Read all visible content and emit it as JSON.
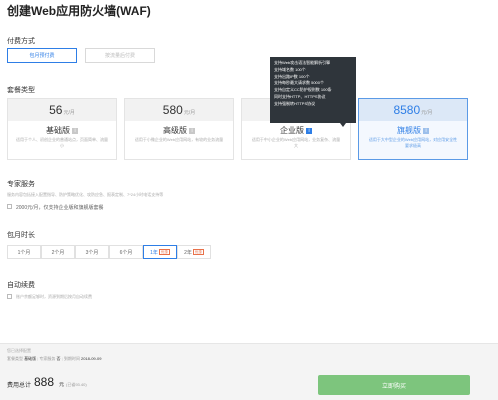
{
  "page_title": "创建Web应用防火墙(WAF)",
  "payment": {
    "label": "付费方式",
    "options": [
      "包月预付费",
      "按流量后付费"
    ]
  },
  "package": {
    "label": "套餐类型",
    "unit": "元/月",
    "info_icon_text": "i",
    "plans": [
      {
        "price": "56",
        "name": "基础版",
        "desc": "适用于个人、初创企业的普通站点，页面简单、流量小"
      },
      {
        "price": "580",
        "name": "高级版",
        "desc": "适用于小微企业的Web应用网站，有较的业务流量"
      },
      {
        "price": "",
        "name": "企业版",
        "desc": "适用于中小企业的Web应用网站，业务复杂、流量大"
      },
      {
        "price": "8580",
        "name": "旗舰版",
        "desc": "适用于大中型企业的Web应用网站，对应用安全性要求极高"
      }
    ]
  },
  "tooltip": {
    "lines": [
      "支持Web攻击语法智能解析引擎",
      "支持域名数 100个",
      "支持出路IP数 100个",
      "支持每秒最大请求数 5000个",
      "支持自定义CC防护规则数 100条",
      "同时支持HTTP、HTTPS协议",
      "支持强制转HTTPS协议"
    ]
  },
  "expert": {
    "label": "专家服务",
    "desc": "服务内容包括接入配置指导、防护策略优化、攻防应急、报表定制、7*24小时电话支持等",
    "checkbox_label": "2000元/月，仅支持企业版和旗舰版套餐"
  },
  "duration": {
    "label": "包月时长",
    "options": [
      "1个月",
      "2个月",
      "3个月",
      "6个月",
      "1年",
      "2年"
    ],
    "badge": "优惠"
  },
  "renew": {
    "label": "自动续费",
    "checkbox_label": "账户余额足够时，资源到期后按月自动续费"
  },
  "footer": {
    "selected_label": "您已选择配置",
    "summary": [
      "套餐类型",
      "基础版",
      "专家服务",
      "否",
      "到期时间",
      "2018-09-09"
    ],
    "total_label": "费用总计",
    "total_amount": "888",
    "total_unit": "元",
    "discount": "(已省93.40)",
    "buy_button": "立即购买"
  }
}
